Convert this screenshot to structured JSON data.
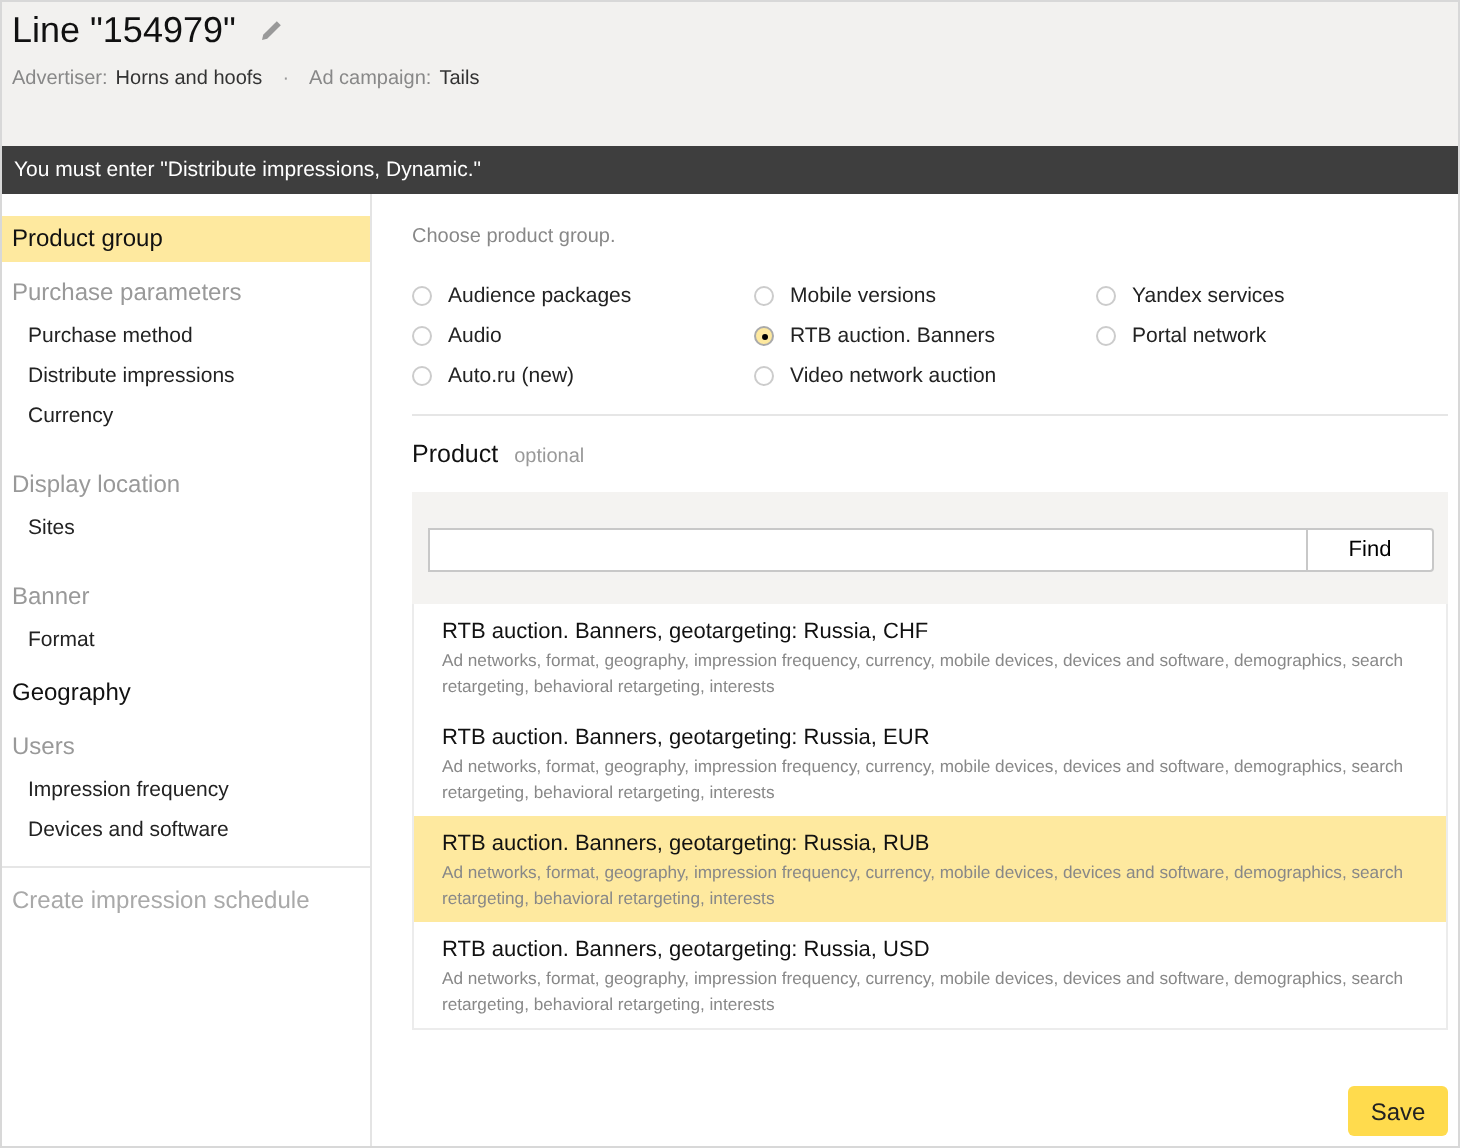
{
  "header": {
    "title": "Line \"154979\"",
    "meta": [
      {
        "label": "Advertiser:",
        "value": "Horns and hoofs"
      },
      {
        "label": "Ad campaign:",
        "value": "Tails"
      }
    ],
    "separator": "·"
  },
  "alert": "You must enter \"Distribute impressions, Dynamic.\"",
  "sidebar": {
    "items": [
      {
        "kind": "link",
        "label": "Product group",
        "selected": true,
        "disabled": false
      },
      {
        "kind": "heading",
        "label": "Purchase parameters",
        "selected": false,
        "disabled": false
      },
      {
        "kind": "subitem",
        "label": "Purchase method",
        "selected": false,
        "disabled": false
      },
      {
        "kind": "subitem",
        "label": "Distribute impressions",
        "selected": false,
        "disabled": false
      },
      {
        "kind": "subitem",
        "label": "Currency",
        "selected": false,
        "disabled": false
      },
      {
        "kind": "heading",
        "label": "Display location",
        "selected": false,
        "disabled": false
      },
      {
        "kind": "subitem",
        "label": "Sites",
        "selected": false,
        "disabled": false
      },
      {
        "kind": "heading",
        "label": "Banner",
        "selected": false,
        "disabled": false
      },
      {
        "kind": "subitem",
        "label": "Format",
        "selected": false,
        "disabled": false
      },
      {
        "kind": "link",
        "label": "Geography",
        "selected": false,
        "disabled": false
      },
      {
        "kind": "heading",
        "label": "Users",
        "selected": false,
        "disabled": false
      },
      {
        "kind": "subitem",
        "label": "Impression frequency",
        "selected": false,
        "disabled": false
      },
      {
        "kind": "subitem",
        "label": "Devices and software",
        "selected": false,
        "disabled": false
      },
      {
        "kind": "action",
        "label": "Create impression schedule",
        "selected": false,
        "disabled": true
      }
    ]
  },
  "product_group": {
    "hint": "Choose product group.",
    "options": [
      {
        "label": "Audience packages",
        "selected": false
      },
      {
        "label": "Audio",
        "selected": false
      },
      {
        "label": "Auto.ru (new)",
        "selected": false
      },
      {
        "label": "Mobile versions",
        "selected": false
      },
      {
        "label": "RTB auction. Banners",
        "selected": true
      },
      {
        "label": "Video network auction",
        "selected": false
      },
      {
        "label": "Yandex services",
        "selected": false
      },
      {
        "label": "Portal network",
        "selected": false
      }
    ]
  },
  "product": {
    "title": "Product",
    "note": "optional",
    "search_button": "Find",
    "items": [
      {
        "name": "RTB auction. Banners, geotargeting: Russia, CHF",
        "description": "Ad networks, format, geography, impression frequency, currency, mobile devices, devices and software, demographics, search retargeting, behavioral retargeting, interests",
        "selected": false
      },
      {
        "name": "RTB auction. Banners, geotargeting: Russia, EUR",
        "description": "Ad networks, format, geography, impression frequency, currency, mobile devices, devices and software, demographics, search retargeting, behavioral retargeting, interests",
        "selected": false
      },
      {
        "name": "RTB auction. Banners, geotargeting: Russia, RUB",
        "description": "Ad networks, format, geography, impression frequency, currency, mobile devices, devices and software, demographics, search retargeting, behavioral retargeting, interests",
        "selected": true
      },
      {
        "name": "RTB auction. Banners, geotargeting: Russia, USD",
        "description": "Ad networks, format, geography, impression frequency, currency, mobile devices, devices and software, demographics, search retargeting, behavioral retargeting, interests",
        "selected": false
      }
    ]
  },
  "save_button": "Save"
}
